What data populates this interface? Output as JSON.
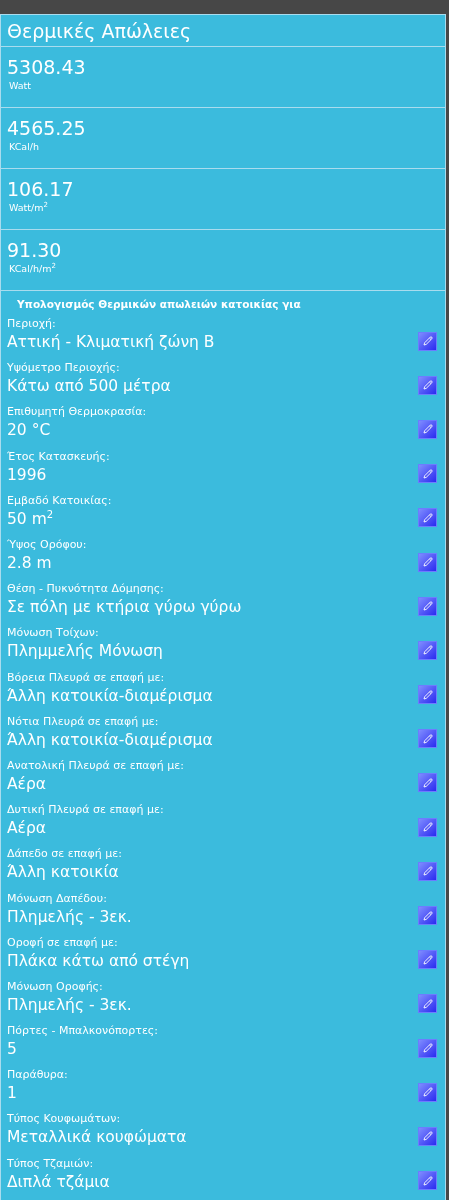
{
  "title": "Θερμικές Απώλειες",
  "results": [
    {
      "value": "5308.43",
      "unit": "Watt"
    },
    {
      "value": "4565.25",
      "unit": "KCal/h"
    },
    {
      "value": "106.17",
      "unit": "Watt/m$^{2}$"
    },
    {
      "value": "91.30",
      "unit": "KCal/h/m$^{2}$"
    }
  ],
  "section_heading": "Υπολογισμός Θερμικών απωλειών κατοικίας για",
  "fields": [
    {
      "label": "Περιοχή:",
      "value": "Αττική - Κλιματική ζώνη Β"
    },
    {
      "label": "Υψόμετρο Περιοχής:",
      "value": "Κάτω από 500 μέτρα"
    },
    {
      "label": "Επιθυμητή Θερμοκρασία:",
      "value": "20 °C"
    },
    {
      "label": "Έτος Κατασκευής:",
      "value": "1996"
    },
    {
      "label": "Εμβαδό Κατοικίας:",
      "value": "50 m$^{2}$"
    },
    {
      "label": "Ύψος Ορόφου:",
      "value": "2.8 m"
    },
    {
      "label": "Θέση - Πυκνότητα Δόμησης:",
      "value": "Σε πόλη με κτήρια γύρω γύρω"
    },
    {
      "label": "Μόνωση Τοίχων:",
      "value": "Πλημμελής Μόνωση"
    },
    {
      "label": "Βόρεια Πλευρά σε επαφή με:",
      "value": "Άλλη κατοικία-διαμέρισμα"
    },
    {
      "label": "Νότια Πλευρά σε επαφή με:",
      "value": "Άλλη κατοικία-διαμέρισμα"
    },
    {
      "label": "Ανατολική Πλευρά σε επαφή με:",
      "value": "Αέρα"
    },
    {
      "label": "Δυτική Πλευρά σε επαφή με:",
      "value": "Αέρα"
    },
    {
      "label": "Δάπεδο σε επαφή με:",
      "value": "Άλλη κατοικία"
    },
    {
      "label": "Μόνωση Δαπέδου:",
      "value": "Πλημελής - 3εκ."
    },
    {
      "label": "Οροφή σε επαφή με:",
      "value": "Πλάκα κάτω από στέγη"
    },
    {
      "label": "Μόνωση Οροφής:",
      "value": "Πλημελής - 3εκ."
    },
    {
      "label": "Πόρτες - Μπαλκονόπορτες:",
      "value": "5"
    },
    {
      "label": "Παράθυρα:",
      "value": "1"
    },
    {
      "label": "Τύπος Κουφωμάτων:",
      "value": "Μεταλλικά κουφώματα"
    },
    {
      "label": "Τύπος Τζαμιών:",
      "value": "Διπλά τζάμια"
    }
  ]
}
